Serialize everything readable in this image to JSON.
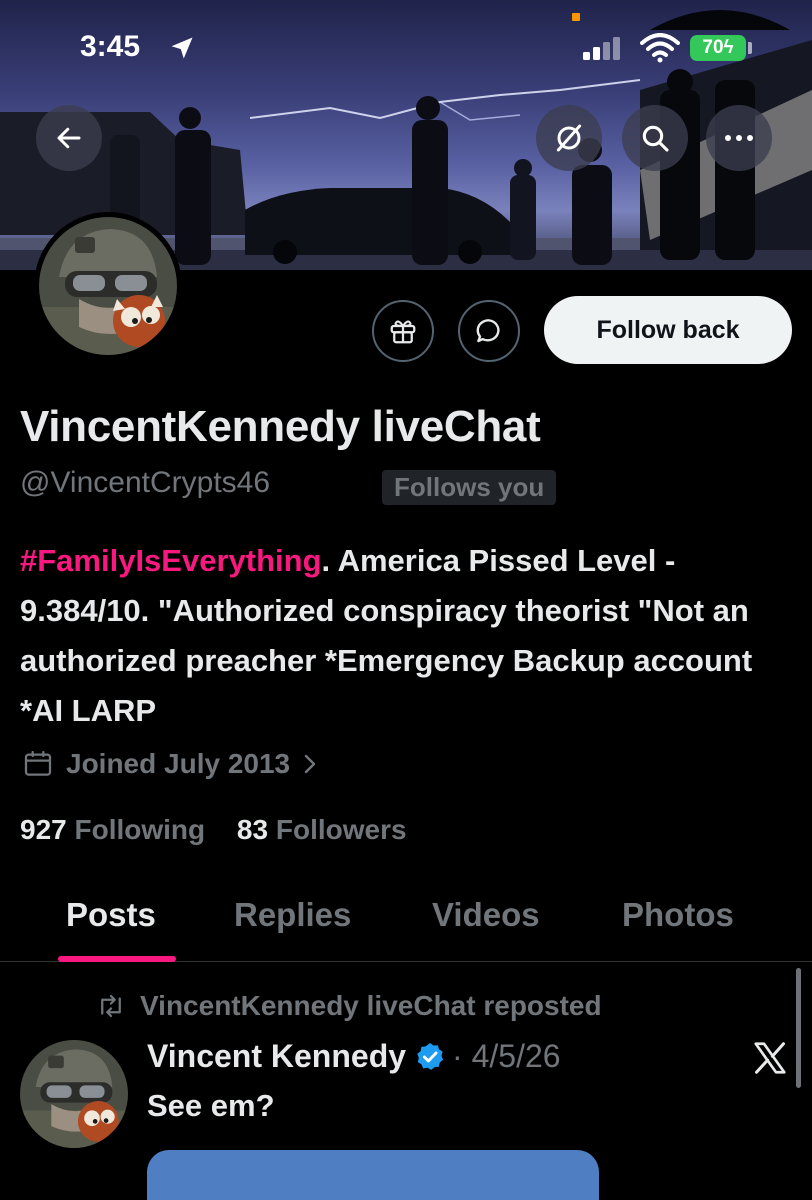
{
  "status_bar": {
    "time": "3:45",
    "battery": "70"
  },
  "colors": {
    "accent_pink": "#f91880",
    "muted": "#71767b",
    "verified_blue": "#1d9bf0"
  },
  "banner": {
    "icons": [
      "back-arrow-icon",
      "grok-icon",
      "search-icon",
      "more-icon"
    ]
  },
  "profile": {
    "follow_label": "Follow back",
    "name": "VincentKennedy liveChat",
    "handle": "@VincentCrypts46",
    "follows_you": "Follows you",
    "bio_tag": "#FamilyIsEverything",
    "bio_rest": ". America Pissed Level - 9.384/10. \"Authorized conspiracy theorist \"Not an authorized preacher *Emergency Backup account *AI LARP",
    "joined": "Joined July 2013",
    "following_count": "927",
    "following_label": "Following",
    "followers_count": "83",
    "followers_label": "Followers"
  },
  "tabs": [
    {
      "label": "Posts",
      "active": true
    },
    {
      "label": "Replies",
      "active": false
    },
    {
      "label": "Videos",
      "active": false
    },
    {
      "label": "Photos",
      "active": false
    }
  ],
  "post": {
    "repost_text": "VincentKennedy liveChat reposted",
    "author": "Vincent Kennedy",
    "date": "· 4/5/26",
    "text": "See em?"
  }
}
